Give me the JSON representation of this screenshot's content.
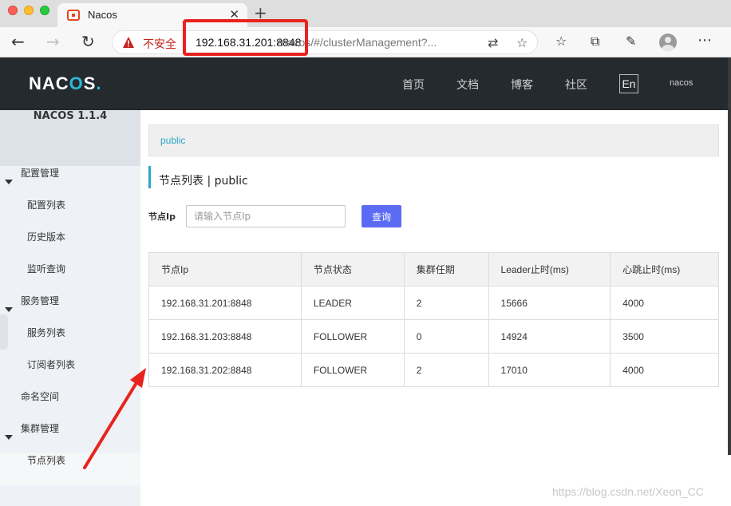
{
  "browser": {
    "tab_title": "Nacos",
    "tab_close": "✕",
    "new_tab": "+",
    "security_label": "不安全",
    "url_host": "192.168.31.201:8848",
    "url_rest": "/nacos/#/clusterManagement?...",
    "icons": [
      "back-icon",
      "forward-icon",
      "reload-icon",
      "warning-icon",
      "translate-icon",
      "star-icon",
      "favorites-icon",
      "collections-icon",
      "feedback-icon",
      "profile-icon",
      "more-icon"
    ]
  },
  "header": {
    "logo": "NACOS.",
    "nav": [
      "首页",
      "文档",
      "博客",
      "社区"
    ],
    "lang": "En",
    "user": "nacos",
    "accent": "#2ab9d6"
  },
  "sidebar": {
    "title": "NACOS 1.1.4",
    "groups": [
      {
        "label": "配置管理",
        "items": [
          "配置列表",
          "历史版本",
          "监听查询"
        ]
      },
      {
        "label": "服务管理",
        "items": [
          "服务列表",
          "订阅者列表"
        ]
      },
      {
        "label": "命名空间"
      },
      {
        "label": "集群管理",
        "items": [
          "节点列表"
        ]
      }
    ]
  },
  "main": {
    "breadcrumb": "public",
    "title": "节点列表 | public",
    "filter_label": "节点Ip",
    "filter_placeholder": "请输入节点Ip",
    "query_button": "查询",
    "query_button_color": "#5b6bf3",
    "table": {
      "columns": [
        "节点Ip",
        "节点状态",
        "集群任期",
        "Leader止时(ms)",
        "心跳止时(ms)"
      ],
      "rows": [
        [
          "192.168.31.201:8848",
          "LEADER",
          "2",
          "15666",
          "4000"
        ],
        [
          "192.168.31.203:8848",
          "FOLLOWER",
          "0",
          "14924",
          "3500"
        ],
        [
          "192.168.31.202:8848",
          "FOLLOWER",
          "2",
          "17010",
          "4000"
        ]
      ]
    }
  },
  "watermark": "https://blog.csdn.net/Xeon_CC"
}
